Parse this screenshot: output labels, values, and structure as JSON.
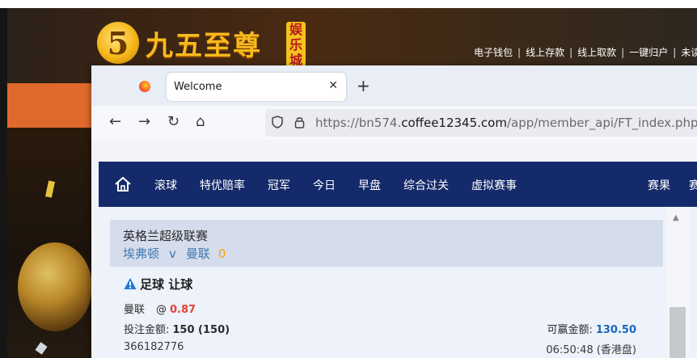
{
  "background_site": {
    "logo_mark": "5",
    "logo_text": "九五至尊",
    "logo_badge": [
      "娱",
      "乐",
      "城"
    ],
    "top_links": [
      "电子钱包",
      "线上存款",
      "线上取款",
      "一键归户",
      "未读"
    ],
    "link_separator": "|"
  },
  "browser": {
    "tab_title": "Welcome",
    "tab_close": "✕",
    "new_tab": "+",
    "nav": {
      "back": "←",
      "forward": "→",
      "reload": "↻",
      "home": "⌂"
    },
    "url_prefix": "https://bn574.",
    "url_domain": "coffee12345.com",
    "url_path": "/app/member_api/FT_index.php?mtype=",
    "icons": [
      "firefox-icon",
      "shield-icon",
      "lock-icon"
    ]
  },
  "site": {
    "nav_items": [
      "滚球",
      "特优赔率",
      "冠军",
      "今日",
      "早盘",
      "综合过关",
      "虚拟赛事"
    ],
    "nav_right": [
      "赛果",
      "赛"
    ],
    "colors": {
      "nav_bg": "#152a6b",
      "odds": "#e0443a",
      "win": "#1a66b8",
      "score": "#f0a30a"
    }
  },
  "bet": {
    "league": "英格兰超级联赛",
    "home_team": "埃弗顿",
    "vs": "v",
    "away_team": "曼联",
    "score": "0",
    "bet_type": "足球 让球",
    "selection": "曼联",
    "at": "@",
    "odds": "0.87",
    "stake_label": "投注金额:",
    "stake_value": "150 (150)",
    "win_label": "可赢金额:",
    "win_value": "130.50",
    "ticket_id": "366182776",
    "time": "06:50:48 (香港盘)"
  }
}
